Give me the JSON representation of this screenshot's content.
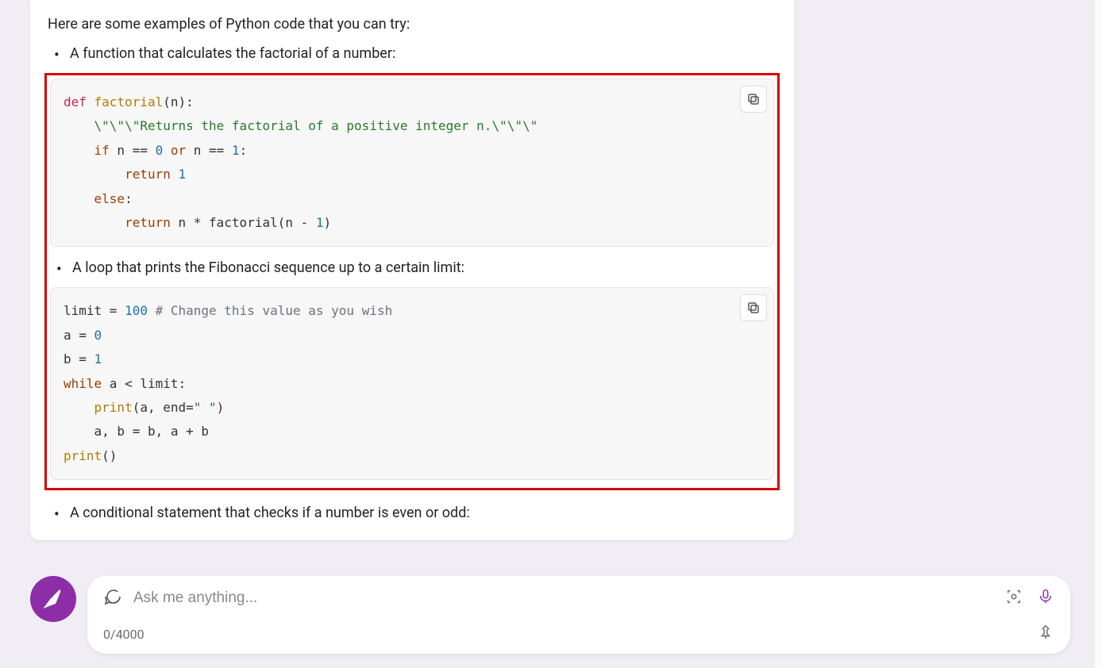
{
  "intro": "Here are some examples of Python code that you can try:",
  "bullets": {
    "factorial": "A function that calculates the factorial of a number:",
    "fibonacci": "A loop that prints the Fibonacci sequence up to a certain limit:",
    "evenodd": "A conditional statement that checks if a number is even or odd:"
  },
  "code": {
    "factorial": {
      "l1a": "def",
      "l1b": " factorial",
      "l1c": "(n):",
      "l2a": "    \\\"\\\"\\\"Returns the factorial of a positive integer n.\\\"\\\"\\\"",
      "l3a": "    if",
      "l3b": " n == ",
      "l3c": "0",
      "l3d": " or",
      "l3e": " n == ",
      "l3f": "1",
      "l3g": ":",
      "l4a": "        return",
      "l4b": " 1",
      "l5a": "    else",
      "l5b": ":",
      "l6a": "        return",
      "l6b": " n * factorial(n - ",
      "l6c": "1",
      "l6d": ")"
    },
    "fibonacci": {
      "l1a": "limit = ",
      "l1b": "100",
      "l1c": " # Change this value as you wish",
      "l2": "a = ",
      "l2b": "0",
      "l3": "b = ",
      "l3b": "1",
      "l4a": "while",
      "l4b": " a < limit:",
      "l5a": "    print",
      "l5b": "(a, end=",
      "l5c": "\" \"",
      "l5d": ")",
      "l6": "    a, b = b, a + b",
      "l7a": "print",
      "l7b": "()"
    }
  },
  "input": {
    "placeholder": "Ask me anything...",
    "counter": "0/4000"
  }
}
